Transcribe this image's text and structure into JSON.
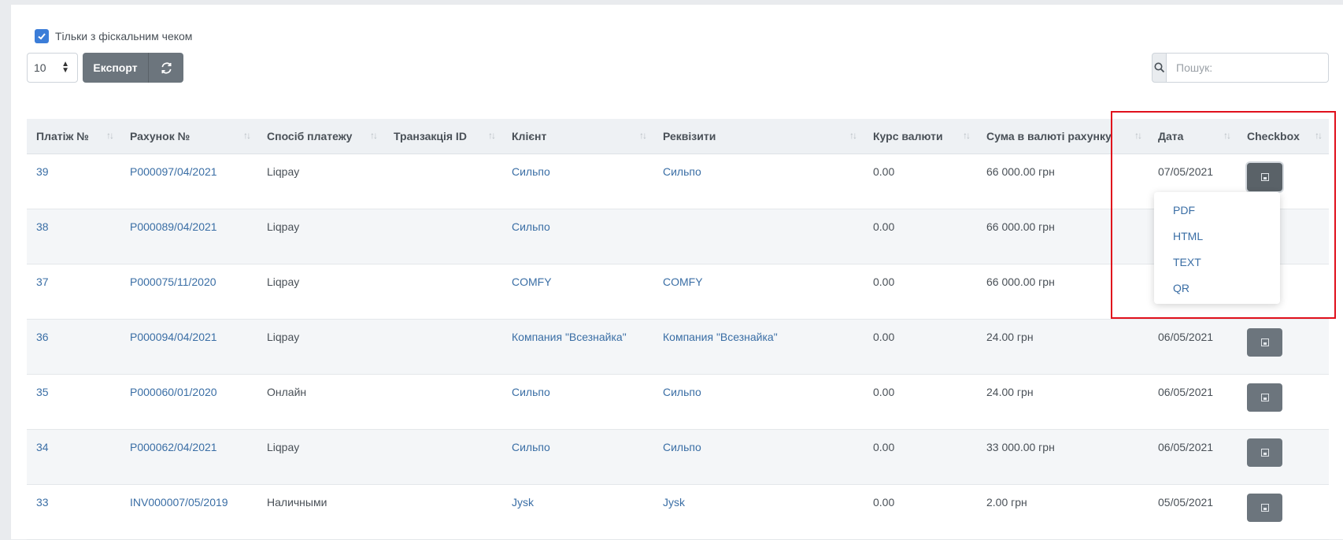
{
  "filters": {
    "fiscal_label": "Тільки з фіскальним чеком",
    "fiscal_checked": true
  },
  "toolbar": {
    "per_page": "10",
    "export_label": "Експорт",
    "refresh_icon": "refresh-icon"
  },
  "search": {
    "placeholder": "Пошук:",
    "icon": "search-icon"
  },
  "table": {
    "columns": [
      "Платіж №",
      "Рахунок №",
      "Спосіб платежу",
      "Транзакція ID",
      "Клієнт",
      "Реквізити",
      "Курс валюти",
      "Сума в валюті рахунку",
      "Дата",
      "Checkbox"
    ],
    "rows": [
      {
        "payment": "39",
        "invoice": "P000097/04/2021",
        "method": "Liqpay",
        "transaction": "",
        "client": "Сильпо",
        "details": "Сильпо",
        "rate": "0.00",
        "amount": "66 000.00 грн",
        "date": "07/05/2021"
      },
      {
        "payment": "38",
        "invoice": "P000089/04/2021",
        "method": "Liqpay",
        "transaction": "",
        "client": "Сильпо",
        "details": "",
        "rate": "0.00",
        "amount": "66 000.00 грн",
        "date": ""
      },
      {
        "payment": "37",
        "invoice": "P000075/11/2020",
        "method": "Liqpay",
        "transaction": "",
        "client": "COMFY",
        "details": "COMFY",
        "rate": "0.00",
        "amount": "66 000.00 грн",
        "date": ""
      },
      {
        "payment": "36",
        "invoice": "P000094/04/2021",
        "method": "Liqpay",
        "transaction": "",
        "client": "Компания \"Всезнайка\"",
        "details": "Компания \"Всезнайка\"",
        "rate": "0.00",
        "amount": "24.00 грн",
        "date": "06/05/2021"
      },
      {
        "payment": "35",
        "invoice": "P000060/01/2020",
        "method": "Онлайн",
        "transaction": "",
        "client": "Сильпо",
        "details": "Сильпо",
        "rate": "0.00",
        "amount": "24.00 грн",
        "date": "06/05/2021"
      },
      {
        "payment": "34",
        "invoice": "P000062/04/2021",
        "method": "Liqpay",
        "transaction": "",
        "client": "Сильпо",
        "details": "Сильпо",
        "rate": "0.00",
        "amount": "33 000.00 грн",
        "date": "06/05/2021"
      },
      {
        "payment": "33",
        "invoice": "INV000007/05/2019",
        "method": "Наличными",
        "transaction": "",
        "client": "Jysk",
        "details": "Jysk",
        "rate": "0.00",
        "amount": "2.00 грн",
        "date": "05/05/2021"
      }
    ]
  },
  "dropdown": {
    "items": [
      "PDF",
      "HTML",
      "TEXT",
      "QR"
    ]
  },
  "colors": {
    "accent": "#3b7dd8",
    "button": "#6c757d",
    "link": "#3a6ea5",
    "highlight": "#e0101c"
  }
}
